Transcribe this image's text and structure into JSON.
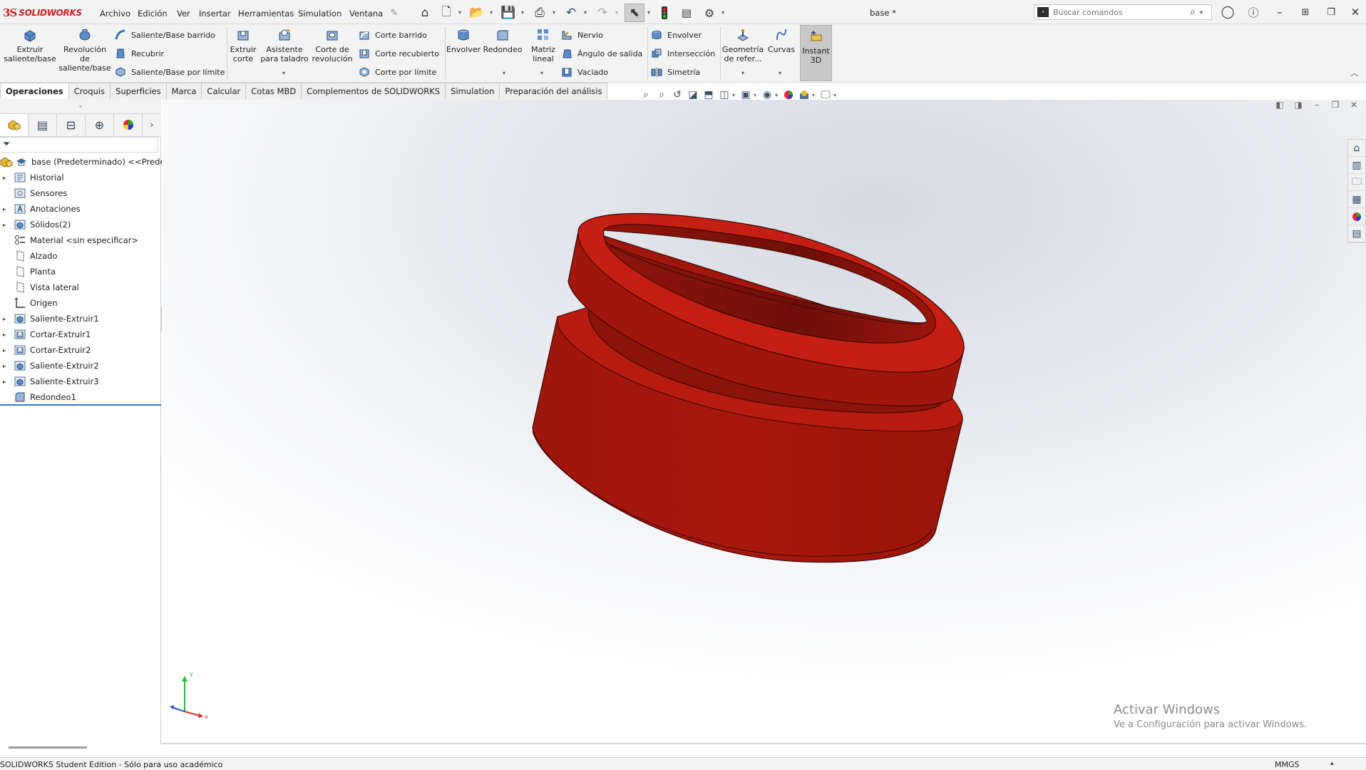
{
  "app": {
    "logo_ds": "3S",
    "logo_name": "SOLIDWORKS",
    "doc_title": "base *"
  },
  "menu": [
    "Archivo",
    "Edición",
    "Ver",
    "Insertar",
    "Herramientas",
    "Simulation",
    "Ventana"
  ],
  "search": {
    "placeholder": "Buscar comandos"
  },
  "commands": {
    "extruir_saliente": "Extruir saliente/base",
    "revolucion_saliente": "Revolución de saliente/base",
    "saliente_barrido": "Saliente/Base barrido",
    "recubrir": "Recubrir",
    "saliente_limite": "Saliente/Base por límite",
    "extruir_corte": "Extruir corte",
    "asistente_taladro": "Asistente para taladro",
    "corte_revolucion": "Corte de revolución",
    "corte_barrido": "Corte barrido",
    "corte_recubierto": "Corte recubierto",
    "corte_limite": "Corte por límite",
    "envolver_1": "Envolver",
    "redondeo": "Redondeo",
    "matriz_lineal": "Matriz lineal",
    "nervio": "Nervio",
    "angulo_salida": "Ángulo de salida",
    "vaciado": "Vaciado",
    "envolver_2": "Envolver",
    "interseccion": "Intersección",
    "simetria": "Simetría",
    "geometria_ref": "Geometría de refer...",
    "curvas": "Curvas",
    "instant3d": "Instant 3D"
  },
  "tabs": [
    {
      "label": "Operaciones",
      "active": true
    },
    {
      "label": "Croquis",
      "active": false
    },
    {
      "label": "Superficies",
      "active": false
    },
    {
      "label": "Marca",
      "active": false
    },
    {
      "label": "Calcular",
      "active": false
    },
    {
      "label": "Cotas MBD",
      "active": false
    },
    {
      "label": "Complementos de SOLIDWORKS",
      "active": false
    },
    {
      "label": "Simulation",
      "active": false
    },
    {
      "label": "Preparación del análisis",
      "active": false
    }
  ],
  "tree": {
    "root": "base (Predeterminado) <<Predete",
    "items": [
      {
        "label": "Historial",
        "expandable": true,
        "icon": "folder-icon"
      },
      {
        "label": "Sensores",
        "expandable": false,
        "icon": "sensor-icon"
      },
      {
        "label": "Anotaciones",
        "expandable": true,
        "icon": "annotation-icon"
      },
      {
        "label": "Sólidos(2)",
        "expandable": true,
        "icon": "solid-bodies-icon"
      },
      {
        "label": "Material <sin especificar>",
        "expandable": false,
        "icon": "material-icon"
      },
      {
        "label": "Alzado",
        "expandable": false,
        "icon": "plane-icon"
      },
      {
        "label": "Planta",
        "expandable": false,
        "icon": "plane-icon"
      },
      {
        "label": "Vista lateral",
        "expandable": false,
        "icon": "plane-icon"
      },
      {
        "label": "Origen",
        "expandable": false,
        "icon": "origin-icon"
      },
      {
        "label": "Saliente-Extruir1",
        "expandable": true,
        "icon": "extrude-icon"
      },
      {
        "label": "Cortar-Extruir1",
        "expandable": true,
        "icon": "cut-icon"
      },
      {
        "label": "Cortar-Extruir2",
        "expandable": true,
        "icon": "cut-icon"
      },
      {
        "label": "Saliente-Extruir2",
        "expandable": true,
        "icon": "extrude-icon"
      },
      {
        "label": "Saliente-Extruir3",
        "expandable": true,
        "icon": "extrude-icon"
      },
      {
        "label": "Redondeo1",
        "expandable": false,
        "icon": "fillet-icon"
      }
    ]
  },
  "viewport": {
    "triad_x": "x",
    "triad_y": "y",
    "activate_title": "Activar Windows",
    "activate_sub": "Ve a Configuración para activar Windows."
  },
  "status": {
    "text": "SOLIDWORKS Student Edition - Sólo para uso académico",
    "units": "MMGS"
  },
  "colors": {
    "model": "#a8170e",
    "accent_red": "#d21f1f"
  }
}
